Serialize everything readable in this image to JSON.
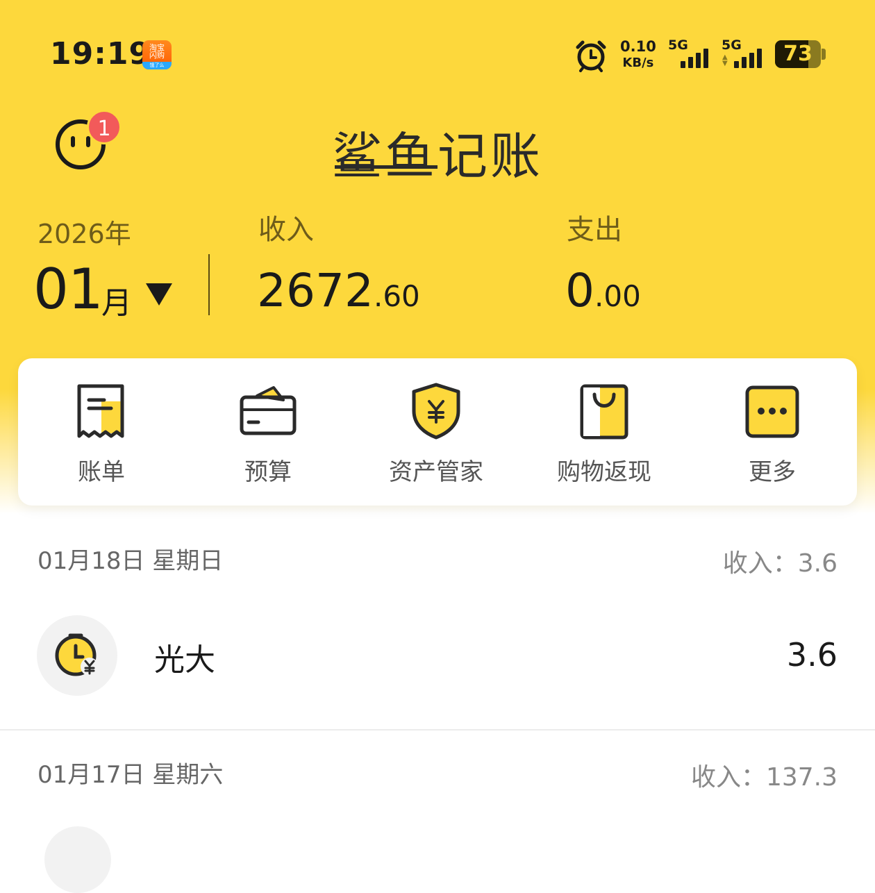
{
  "status_bar": {
    "time": "19:19",
    "taobao_badge_top": "淘宝",
    "taobao_badge_mid": "闪购",
    "taobao_badge_bottom": "饿了么",
    "net_speed_value": "0.10",
    "net_speed_unit": "KB/s",
    "sim1_label": "5G",
    "sim2_label": "5G",
    "battery_percent": "73",
    "battery_level": 0.73,
    "icons": [
      "alarm-icon",
      "signal-icon",
      "battery-icon"
    ]
  },
  "header": {
    "title": "鲨鱼记账",
    "notification_count": "1",
    "avatar_icon": "face-icon"
  },
  "summary": {
    "year": "2026年",
    "month": "01",
    "month_unit": "月",
    "income_label": "收入",
    "income_int": "2672",
    "income_dec": ".60",
    "expense_label": "支出",
    "expense_int": "0",
    "expense_dec": ".00"
  },
  "quick_menu": [
    {
      "label": "账单",
      "icon": "bill-icon"
    },
    {
      "label": "预算",
      "icon": "wallet-icon"
    },
    {
      "label": "资产管家",
      "icon": "shield-yen-icon"
    },
    {
      "label": "购物返现",
      "icon": "shopping-bag-icon"
    },
    {
      "label": "更多",
      "icon": "more-icon"
    }
  ],
  "days": [
    {
      "date": "01月18日 星期日",
      "summary": "收入：3.6",
      "transactions": [
        {
          "name": "光大",
          "amount": "3.6",
          "icon": "clock-yen-icon"
        }
      ]
    },
    {
      "date": "01月17日 星期六",
      "summary": "收入：137.3"
    }
  ],
  "colors": {
    "brand_yellow": "#FDD83C",
    "badge_red": "#F25A5A",
    "icon_dark": "#2a2a2a"
  }
}
